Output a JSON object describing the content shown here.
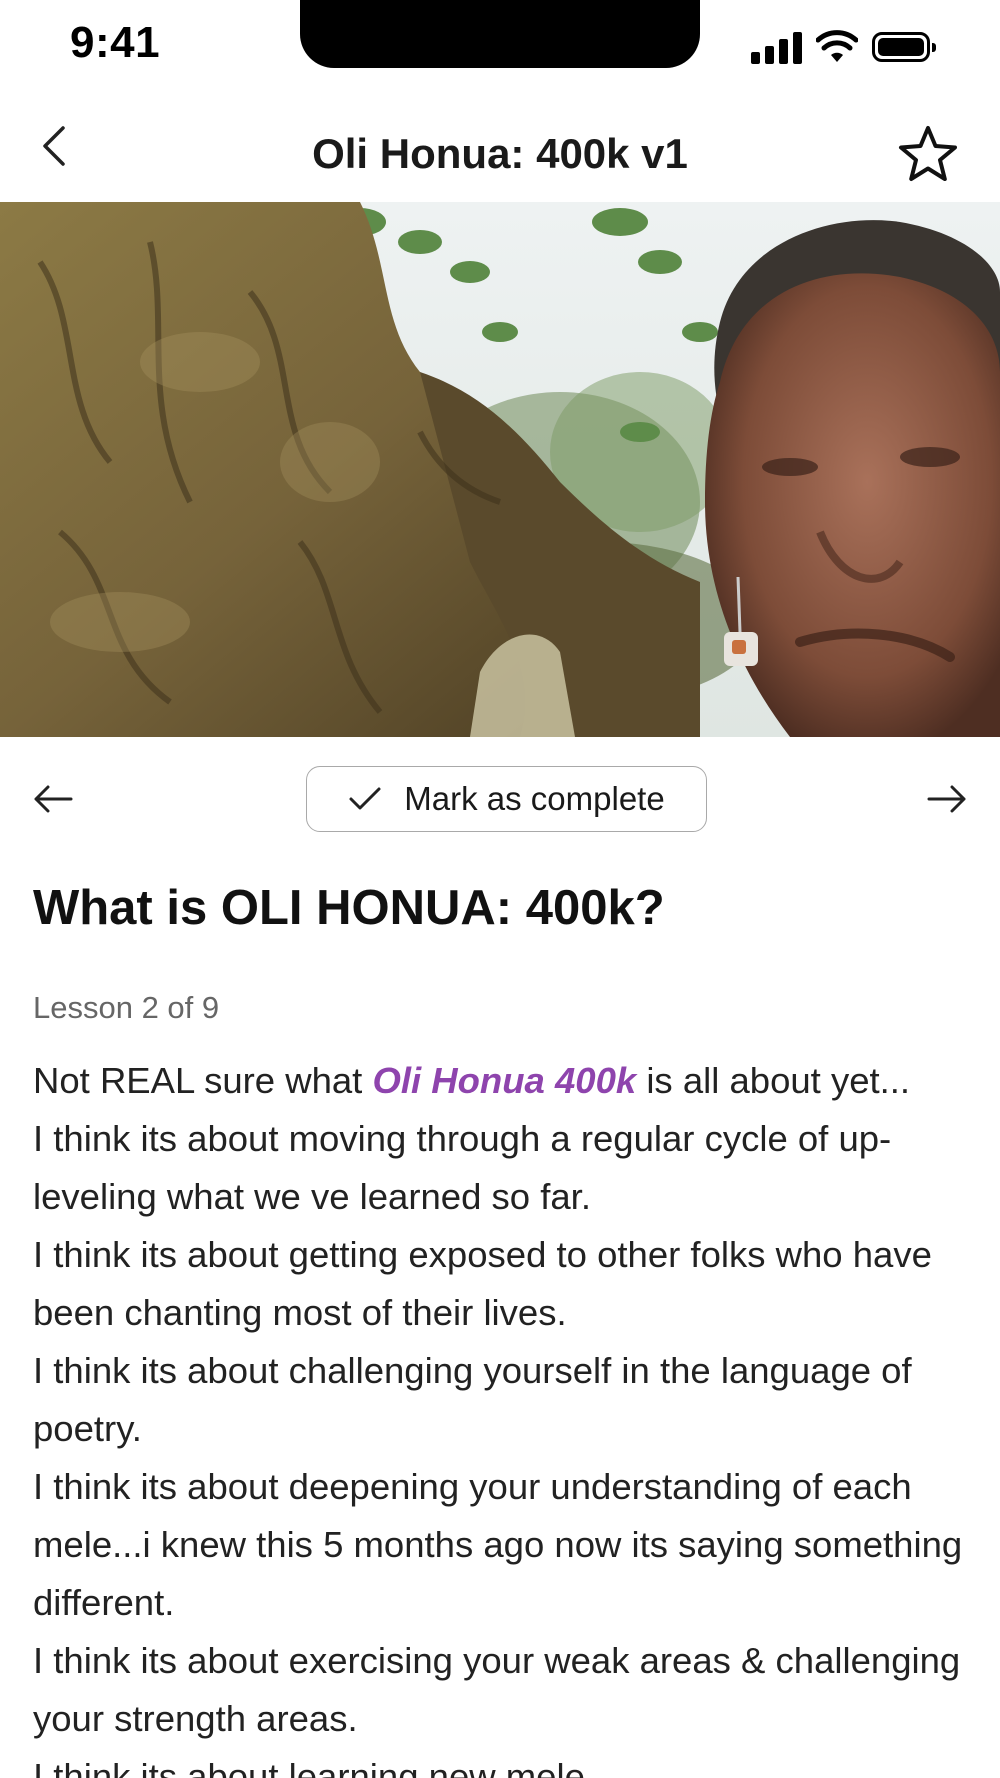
{
  "status_bar": {
    "time": "9:41"
  },
  "header": {
    "title": "Oli Honua: 400k v1"
  },
  "hero": {
    "alt": "Woman looking up beside a large gnarled tree trunk"
  },
  "lesson_nav": {
    "mark_complete_label": "Mark as complete"
  },
  "lesson": {
    "title": "What is OLI HONUA: 400k?",
    "progress": "Lesson 2 of 9",
    "intro_before": "Not REAL sure what ",
    "intro_highlight": "Oli Honua 400k",
    "intro_after": " is all about yet...",
    "paragraphs": [
      "I think its about moving through a regular cycle of up-leveling what we ve learned so far.",
      "I think its about getting exposed to other folks who have been chanting most of their lives.",
      "I think its about challenging yourself in the language of poetry.",
      "I think its about deepening your understanding of each mele...i knew this 5 months ago now its saying something different.",
      "I think its about exercising your weak areas & challenging your strength areas.",
      "I think its about learning new mele."
    ]
  },
  "colors": {
    "accent": "#8e44ad",
    "text": "#222222",
    "muted": "#666666"
  }
}
